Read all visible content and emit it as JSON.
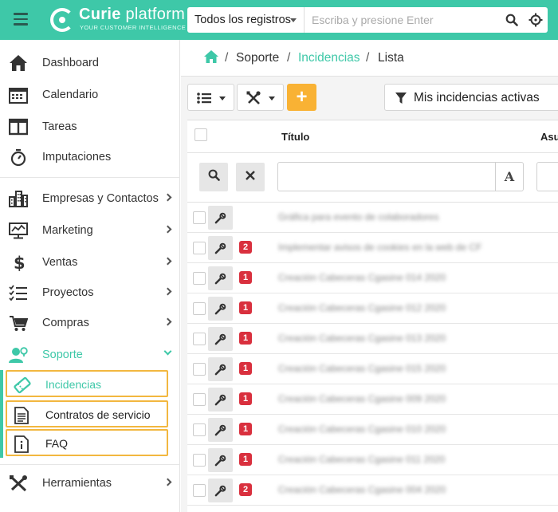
{
  "app": {
    "brand_strong": "Curie",
    "brand_light": "platform",
    "tagline": "YOUR CUSTOMER INTELLIGENCE",
    "accent_color": "#3ec8a8",
    "highlight_color": "#f2b73f"
  },
  "header": {
    "scope_label": "Todos los registros",
    "search_placeholder": "Escriba y presione Enter",
    "search_icon": "search-icon",
    "locate_icon": "crosshair-icon"
  },
  "sidebar": {
    "items": [
      {
        "label": "Dashboard",
        "icon": "home-icon"
      },
      {
        "label": "Calendario",
        "icon": "calendar-icon"
      },
      {
        "label": "Tareas",
        "icon": "columns-icon"
      },
      {
        "label": "Imputaciones",
        "icon": "stopwatch-icon"
      },
      {
        "label": "Empresas y Contactos",
        "icon": "buildings-icon"
      },
      {
        "label": "Marketing",
        "icon": "monitor-chart-icon"
      },
      {
        "label": "Ventas",
        "icon": "dollar-icon"
      },
      {
        "label": "Proyectos",
        "icon": "checklist-icon"
      },
      {
        "label": "Compras",
        "icon": "cart-icon"
      },
      {
        "label": "Soporte",
        "icon": "support-user-icon"
      },
      {
        "label": "Herramientas",
        "icon": "tools-icon"
      }
    ],
    "sub_items": [
      {
        "label": "Incidencias",
        "icon": "ticket-icon"
      },
      {
        "label": "Contratos de servicio",
        "icon": "document-icon"
      },
      {
        "label": "FAQ",
        "icon": "info-icon"
      }
    ]
  },
  "breadcrumb": {
    "part1": "Soporte",
    "part2": "Incidencias",
    "part3": "Lista",
    "separator": "/"
  },
  "toolbar": {
    "add_label": "+",
    "filter_label": "Mis incidencias activas"
  },
  "table": {
    "columns": [
      "Título",
      "Asu"
    ],
    "filter_letter": "A",
    "rows": [
      {
        "badge": "",
        "title": "Gráfica para evento de colaboradores"
      },
      {
        "badge": "2",
        "title": "Implementar avisos de cookies en la web de CF"
      },
      {
        "badge": "1",
        "title": "Creación Cabeceras Cgasine 014 2020"
      },
      {
        "badge": "1",
        "title": "Creación Cabeceras Cgasine 012 2020"
      },
      {
        "badge": "1",
        "title": "Creación Cabeceras Cgasine 013 2020"
      },
      {
        "badge": "1",
        "title": "Creación Cabeceras Cgasine 015 2020"
      },
      {
        "badge": "1",
        "title": "Creación Cabeceras Cgasine 009 2020"
      },
      {
        "badge": "1",
        "title": "Creación Cabeceras Cgasine 010 2020"
      },
      {
        "badge": "1",
        "title": "Creación Cabeceras Cgasine 011 2020"
      },
      {
        "badge": "2",
        "title": "Creación Cabeceras Cgasine 004 2020"
      }
    ]
  }
}
